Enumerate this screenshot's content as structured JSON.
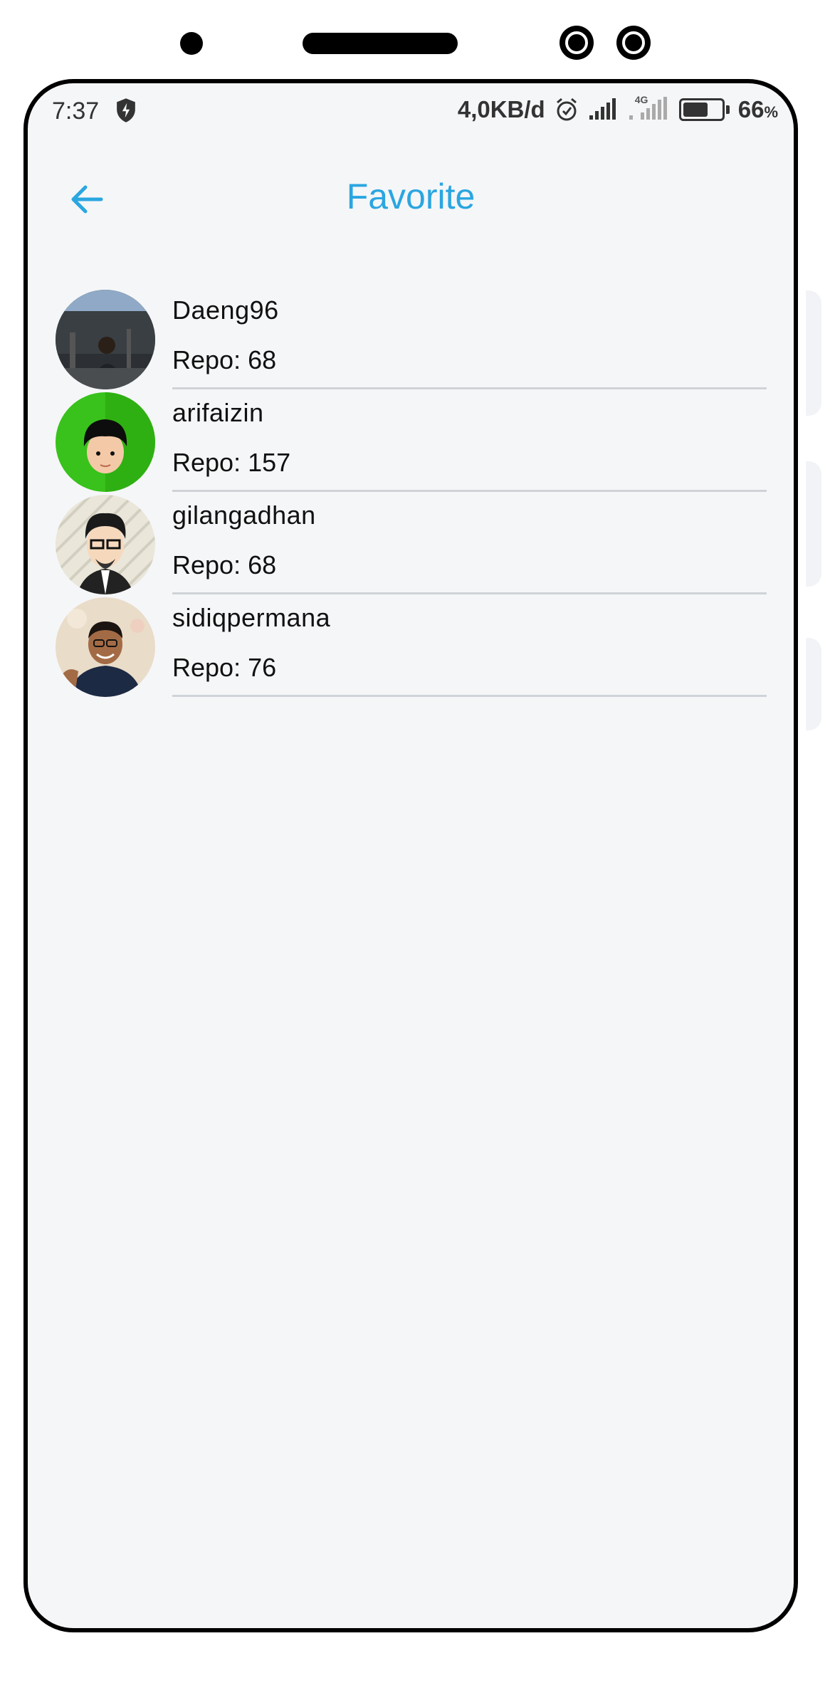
{
  "status_bar": {
    "time": "7:37",
    "network_speed": "4,0KB/d",
    "network_type": "4G",
    "battery_percent": "66",
    "battery_unit": "%",
    "battery_level": 0.66
  },
  "app_bar": {
    "title": "Favorite",
    "back_icon": "arrow-left-icon",
    "accent_color": "#2aa6e0"
  },
  "favorites": [
    {
      "username": "Daeng96",
      "repo_label": "Repo:",
      "repo_count": "68"
    },
    {
      "username": "arifaizin",
      "repo_label": "Repo:",
      "repo_count": "157"
    },
    {
      "username": "gilangadhan",
      "repo_label": "Repo:",
      "repo_count": "68"
    },
    {
      "username": "sidiqpermana",
      "repo_label": "Repo:",
      "repo_count": "76"
    }
  ]
}
